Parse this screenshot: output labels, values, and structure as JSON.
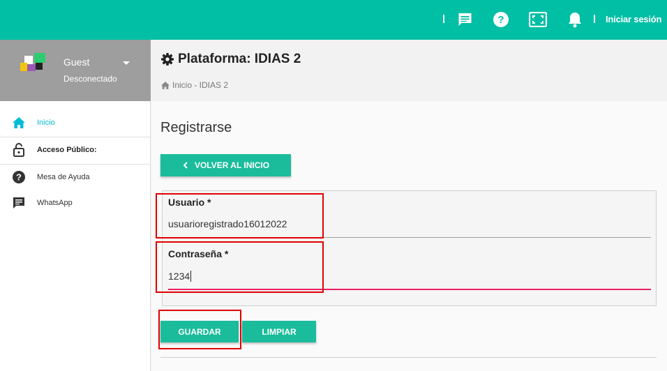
{
  "topbar": {
    "login_label": "Iniciar sesión",
    "icons": [
      "chat-icon",
      "help-icon",
      "fullscreen-icon",
      "bell-icon"
    ],
    "color": "#00bfa5"
  },
  "sidebar": {
    "user": {
      "name": "Guest",
      "status": "Desconectado"
    },
    "items": [
      {
        "label": "Inicio",
        "icon": "home-icon",
        "active": true
      },
      {
        "label": "Acceso Público:",
        "icon": "lock-icon",
        "header": true
      },
      {
        "label": "Mesa de Ayuda",
        "icon": "help-circle-icon"
      },
      {
        "label": "WhatsApp",
        "icon": "message-icon"
      }
    ]
  },
  "header": {
    "title": "Plataforma: IDIAS 2",
    "breadcrumb": "Inicio - IDIAS 2"
  },
  "main": {
    "section_title": "Registrarse",
    "back_button": "VOLVER AL INICIO",
    "form": {
      "username_label": "Usuario *",
      "username_value": "usuarioregistrado16012022",
      "password_label": "Contraseña *",
      "password_value": "1234"
    },
    "save_button": "GUARDAR",
    "clear_button": "LIMPIAR"
  },
  "colors": {
    "accent": "#1abc9c",
    "focus_underline": "#e91e63",
    "highlight_box": "#e00000",
    "active_nav": "#00bcd4"
  }
}
